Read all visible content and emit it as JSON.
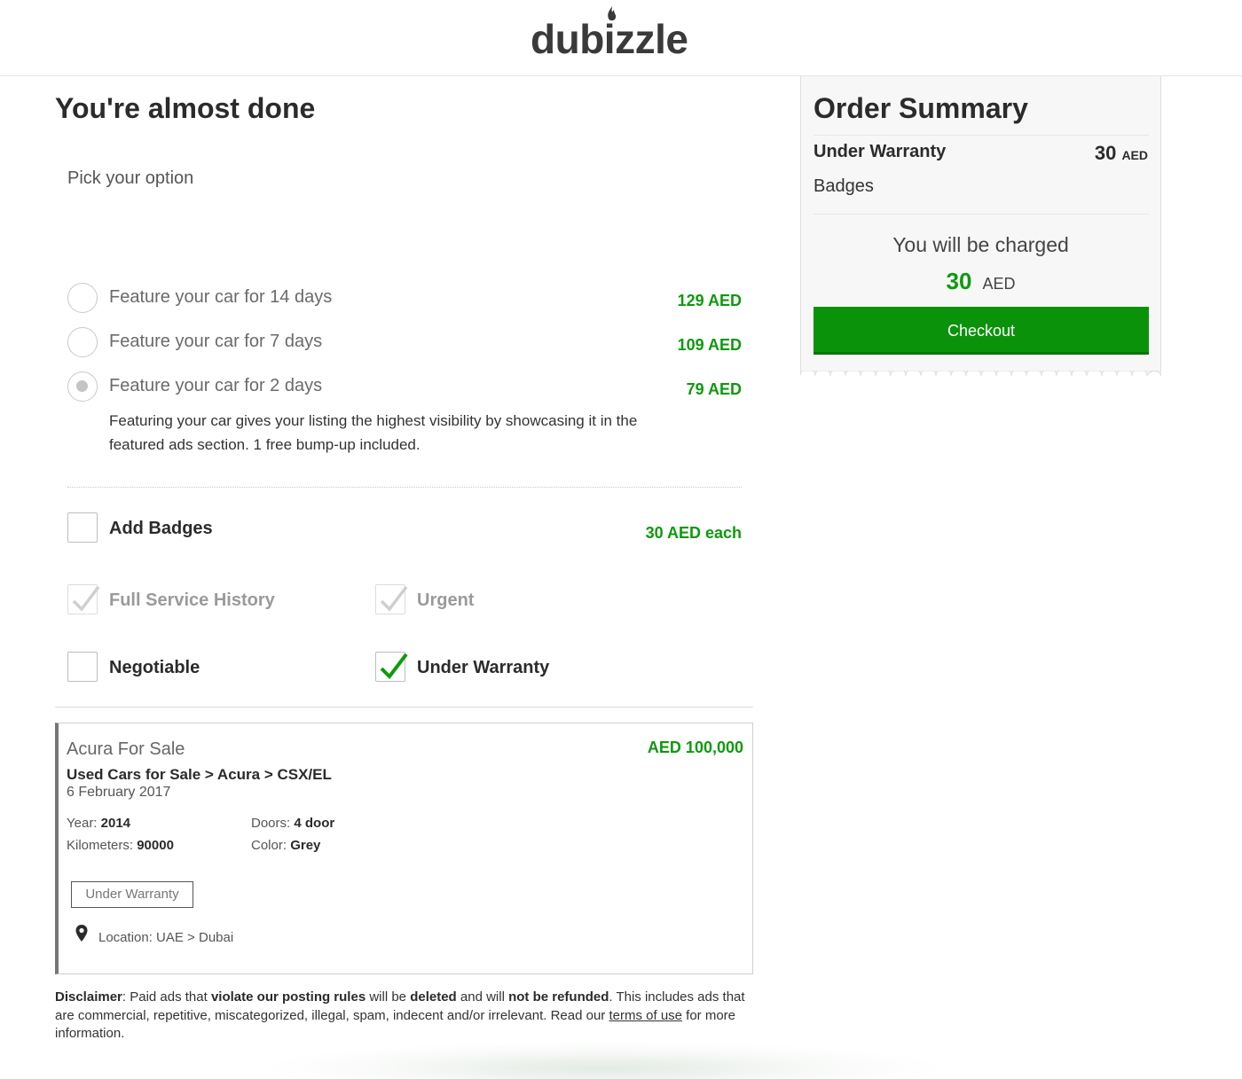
{
  "header": {
    "logo_text": "dubizzle"
  },
  "main": {
    "title": "You're almost done",
    "subtitle": "Pick your option",
    "options": [
      {
        "label": "Feature your car for 14 days",
        "price": "129 AED",
        "selected": false
      },
      {
        "label": "Feature your car for 7 days",
        "price": "109 AED",
        "selected": false
      },
      {
        "label": "Feature your car for 2 days",
        "price": "79 AED",
        "selected": true
      }
    ],
    "option_description": "Featuring your car gives your listing the highest visibility by showcasing it in the featured ads section. 1 free bump-up included.",
    "badges": {
      "label": "Add Badges",
      "price": "30 AED each",
      "items": [
        {
          "label": "Full Service History",
          "checked": true,
          "disabled": true
        },
        {
          "label": "Urgent",
          "checked": true,
          "disabled": true
        },
        {
          "label": "Negotiable",
          "checked": false,
          "disabled": false
        },
        {
          "label": "Under Warranty",
          "checked": true,
          "disabled": false
        }
      ]
    }
  },
  "listing": {
    "title": "Acura For Sale",
    "price": "AED 100,000",
    "breadcrumb": "Used Cars for Sale > Acura > CSX/EL",
    "date": "6 February 2017",
    "specs": {
      "year_label": "Year:",
      "year": "2014",
      "km_label": "Kilometers:",
      "km": "90000",
      "doors_label": "Doors:",
      "doors": "4 door",
      "color_label": "Color:",
      "color": "Grey"
    },
    "tag": "Under Warranty",
    "location": "Location: UAE > Dubai"
  },
  "disclaimer": {
    "label": "Disclaimer",
    "t1": ": Paid ads that ",
    "b1": "violate our posting rules",
    "t2": " will be ",
    "b2": "deleted",
    "t3": " and will ",
    "b3": "not be refunded",
    "t4": ". This includes ads that are commercial, repetitive, miscategorized, illegal, spam, indecent and/or irrelevant. Read our ",
    "link": "terms of use",
    "t5": " for more information."
  },
  "summary": {
    "title": "Order Summary",
    "item": "Under Warranty",
    "item_price": "30",
    "item_currency": "AED",
    "item2": "Badges",
    "charged_label": "You will be charged",
    "charged_amount": "30",
    "charged_currency": "AED",
    "checkout_label": "Checkout"
  },
  "colors": {
    "accent_green": "#0a930a",
    "price_green": "#0d9a0d"
  }
}
